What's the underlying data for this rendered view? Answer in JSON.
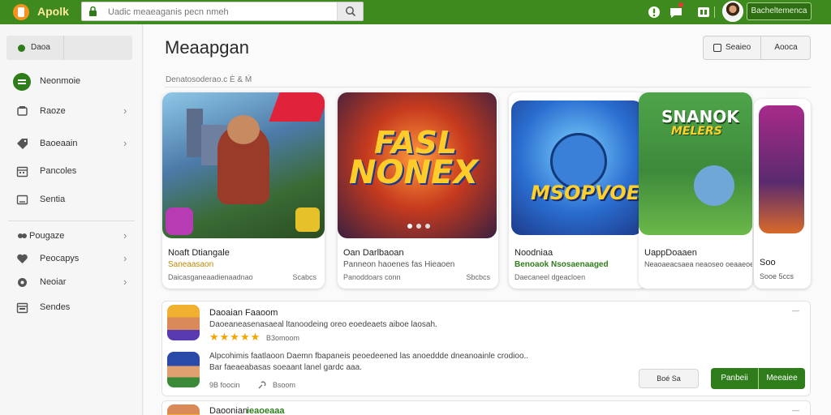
{
  "app": {
    "logo_text": "Apolk",
    "profile_label": "Bacheltemenca"
  },
  "search": {
    "placeholder": "Uadic meaeaganis pecn nmeh"
  },
  "sidebar": {
    "top_label": "Daoa",
    "items": [
      {
        "label": "Neonmoie"
      },
      {
        "label": "Raoze"
      },
      {
        "label": "Baoeaain"
      },
      {
        "label": "Pancoles"
      },
      {
        "label": "Sentia"
      },
      {
        "label": "Pougaze"
      },
      {
        "label": "Peocapys"
      },
      {
        "label": "Neoiar"
      },
      {
        "label": "Sendes"
      }
    ]
  },
  "main": {
    "title": "Meaapgan",
    "subline": "Denatosoderao.c È & Ḿ",
    "btn_left": "Seaieo",
    "btn_right": "Aooca"
  },
  "cards": [
    {
      "name": "Noaft Dtiangale",
      "sub": "Saneaasaon",
      "meta": "Daicasganeaadienaadnao",
      "size": "Scabcs"
    },
    {
      "art_title_1": "FASL",
      "art_title_2": "NONEX",
      "name": "Oan Darlbaoan",
      "sub": "Panneon haoenes fas Hieaoen",
      "meta": "Panoddoars conn",
      "size": "Sbcbcs"
    },
    {
      "art_title": "MSOPVOE",
      "name": "Noodniaa",
      "sub": "Benoaok Nsosaenaaged",
      "meta": "Daecaneel dgeacloen",
      "size": ""
    },
    {
      "art_title_1": "SNANOK",
      "art_title_2": "MELERS",
      "name": "UappDoaaen",
      "sub": "Neaoaeacsaea neaoseo oeaaeoe",
      "meta": "",
      "size": ""
    },
    {
      "name": "Soo",
      "sub": "Sooe 5ccs",
      "meta": "",
      "size": ""
    }
  ],
  "list": {
    "item1_title": "Daoaian Faaoom",
    "item1_desc": "Daoeaneasenasaeal ltanoodeing oreo eoedeaets aiboe laosah.",
    "item1_rating": "★★★★★",
    "item1_count": "B3omoom",
    "item2_desc_1": "Alpcohimis faatlaoon Daemn fbapaneis peoedeened las anoeddde dneanoainle crodioo..",
    "item2_desc_2": "Bar faeaeabasas soeaant lanel gardc aaa.",
    "item2_meta_1": "9B foocin",
    "item2_meta_2": "Bsoom",
    "pill": "Boé Sa",
    "btn_primary": "Panbeii",
    "btn_secondary": "Meeaiee",
    "item3_title": "Daoonian",
    "item3_badge": "ieaoeaaa",
    "close_glyph": "—"
  },
  "colors": {
    "topbar": "#3e8a1e",
    "accent_green": "#2e7d1a",
    "logo_orange": "#f6921e",
    "star": "#f2a400",
    "badge_red": "#e53935"
  },
  "icons": [
    "logo-icon",
    "lock-icon",
    "search-icon",
    "bell-icon",
    "chat-icon",
    "grid-icon",
    "store-icon",
    "gamepad-icon",
    "calendar-icon",
    "folder-icon",
    "tag-icon",
    "controller-icon",
    "heart-icon",
    "calendar-icon",
    "checkbox-icon",
    "link-icon"
  ]
}
